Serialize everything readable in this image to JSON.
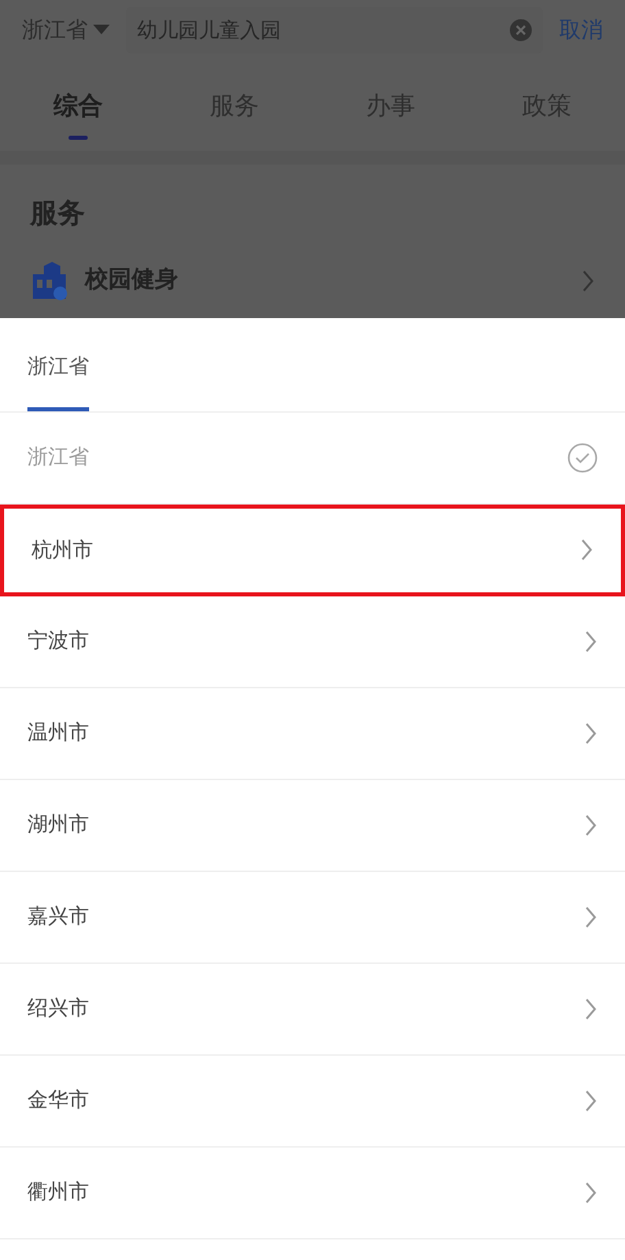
{
  "search_bar": {
    "region": "浙江省",
    "query": "幼儿园儿童入园",
    "cancel": "取消"
  },
  "tabs": [
    {
      "label": "综合",
      "selected": true
    },
    {
      "label": "服务",
      "selected": false
    },
    {
      "label": "办事",
      "selected": false
    },
    {
      "label": "政策",
      "selected": false
    }
  ],
  "section": {
    "title": "服务",
    "items": [
      {
        "label": "校园健身"
      }
    ]
  },
  "region_picker": {
    "tabs": [
      {
        "label": "浙江省",
        "selected": true
      }
    ],
    "options": [
      {
        "label": "浙江省",
        "kind": "current",
        "selected": true,
        "highlighted": false
      },
      {
        "label": "杭州市",
        "kind": "city",
        "selected": false,
        "highlighted": true
      },
      {
        "label": "宁波市",
        "kind": "city",
        "selected": false,
        "highlighted": false
      },
      {
        "label": "温州市",
        "kind": "city",
        "selected": false,
        "highlighted": false
      },
      {
        "label": "湖州市",
        "kind": "city",
        "selected": false,
        "highlighted": false
      },
      {
        "label": "嘉兴市",
        "kind": "city",
        "selected": false,
        "highlighted": false
      },
      {
        "label": "绍兴市",
        "kind": "city",
        "selected": false,
        "highlighted": false
      },
      {
        "label": "金华市",
        "kind": "city",
        "selected": false,
        "highlighted": false
      },
      {
        "label": "衢州市",
        "kind": "city",
        "selected": false,
        "highlighted": false
      }
    ]
  }
}
